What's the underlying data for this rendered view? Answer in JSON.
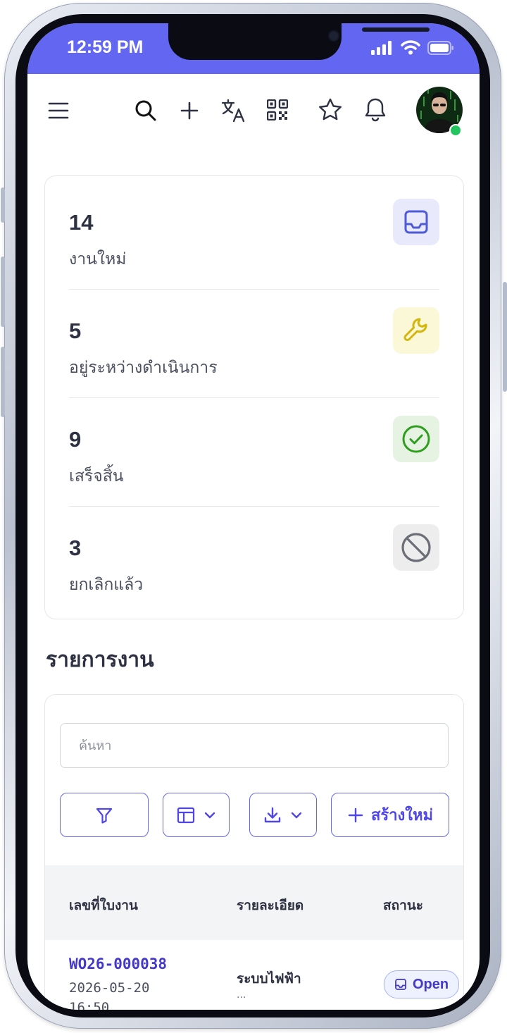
{
  "status_bar": {
    "time": "12:59 PM",
    "icons": [
      "signal-icon",
      "wifi-icon",
      "battery-icon"
    ],
    "color": "#6366f1"
  },
  "topnav": {
    "icons": [
      "menu-icon",
      "search-icon",
      "plus-icon",
      "translate-icon",
      "qr-code-icon",
      "star-icon",
      "bell-icon"
    ],
    "avatar_online": true
  },
  "stats": [
    {
      "value": "14",
      "label": "งานใหม่",
      "icon": "inbox-icon",
      "icon_color": "#4f5bd5",
      "bg": "#e8eafc"
    },
    {
      "value": "5",
      "label": "อยู่ระหว่างดำเนินการ",
      "icon": "wrench-icon",
      "icon_color": "#d4b50c",
      "bg": "#fbf8d8"
    },
    {
      "value": "9",
      "label": "เสร็จสิ้น",
      "icon": "check-circle-icon",
      "icon_color": "#2f9e1f",
      "bg": "#e6f3e2"
    },
    {
      "value": "3",
      "label": "ยกเลิกแล้ว",
      "icon": "ban-icon",
      "icon_color": "#6b6e76",
      "bg": "#ededee"
    }
  ],
  "worklist": {
    "title": "รายการงาน",
    "search_placeholder": "ค้นหา",
    "buttons": {
      "filter": "filter-icon",
      "columns": "columns-icon",
      "download": "download-icon",
      "create_label": "สร้างใหม่"
    },
    "columns": [
      "เลขที่ใบงาน",
      "รายละเอียด",
      "สถานะ"
    ],
    "rows": [
      {
        "id": "WO26-000038",
        "date": "2026-05-20 16:50",
        "description": "ระบบไฟฟ้า",
        "description_more": "...",
        "status": "Open"
      }
    ]
  }
}
